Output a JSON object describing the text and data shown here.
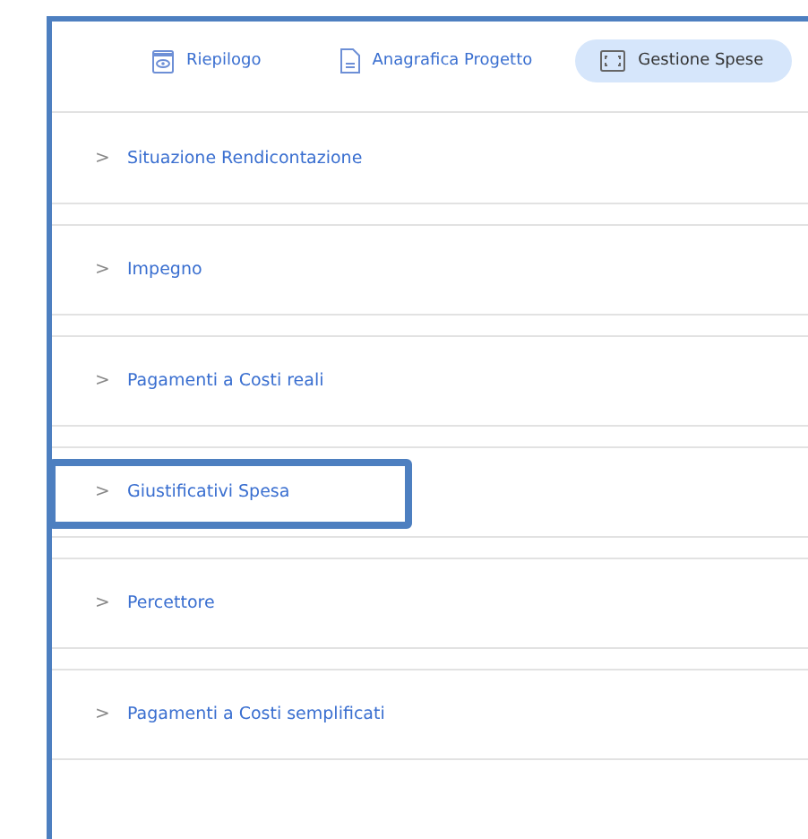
{
  "tabs": [
    {
      "label": "Riepilogo",
      "kind": "eye",
      "selected": false
    },
    {
      "label": "Anagrafica Progetto",
      "kind": "document",
      "selected": false
    },
    {
      "label": "Gestione Spese",
      "kind": "expense",
      "selected": true
    }
  ],
  "sections": [
    {
      "chevron": ">",
      "title": "Situazione Rendicontazione",
      "expanded": false,
      "highlighted": false
    },
    {
      "chevron": ">",
      "title": "Impegno",
      "expanded": false,
      "highlighted": false
    },
    {
      "chevron": ">",
      "title": "Pagamenti a Costi reali",
      "expanded": false,
      "highlighted": false
    },
    {
      "chevron": ">",
      "title": "Giustificativi Spesa",
      "expanded": false,
      "highlighted": true
    },
    {
      "chevron": ">",
      "title": "Percettore",
      "expanded": false,
      "highlighted": false
    },
    {
      "chevron": ">",
      "title": "Pagamenti a Costi semplificati",
      "expanded": false,
      "highlighted": false
    }
  ]
}
